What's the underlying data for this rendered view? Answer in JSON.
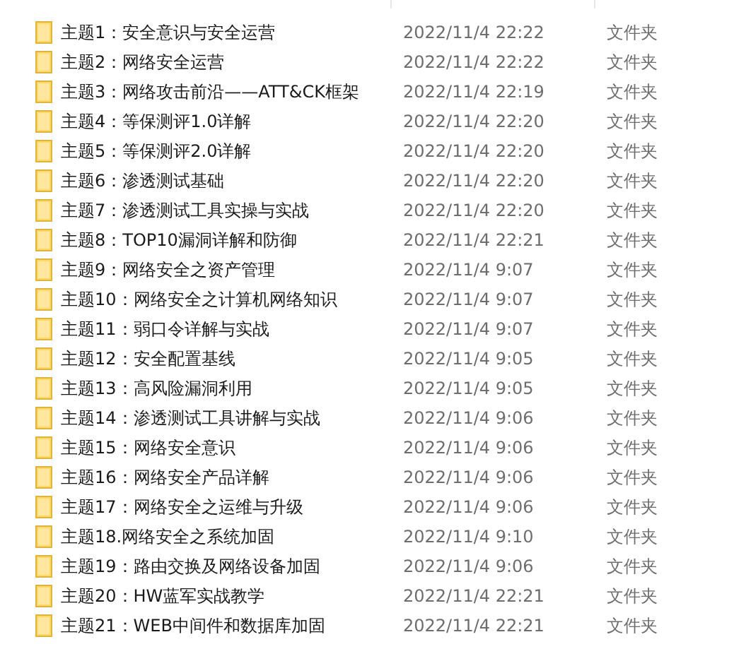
{
  "rows": [
    {
      "name": "主题1：安全意识与安全运营",
      "date": "2022/11/4 22:22",
      "type": "文件夹"
    },
    {
      "name": "主题2：网络安全运营",
      "date": "2022/11/4 22:22",
      "type": "文件夹"
    },
    {
      "name": "主题3：网络攻击前沿——ATT&CK框架",
      "date": "2022/11/4 22:19",
      "type": "文件夹"
    },
    {
      "name": "主题4：等保测评1.0详解",
      "date": "2022/11/4 22:20",
      "type": "文件夹"
    },
    {
      "name": "主题5：等保测评2.0详解",
      "date": "2022/11/4 22:20",
      "type": "文件夹"
    },
    {
      "name": "主题6：渗透测试基础",
      "date": "2022/11/4 22:20",
      "type": "文件夹"
    },
    {
      "name": "主题7：渗透测试工具实操与实战",
      "date": "2022/11/4 22:20",
      "type": "文件夹"
    },
    {
      "name": "主题8：TOP10漏洞详解和防御",
      "date": "2022/11/4 22:21",
      "type": "文件夹"
    },
    {
      "name": "主题9：网络安全之资产管理",
      "date": "2022/11/4 9:07",
      "type": "文件夹"
    },
    {
      "name": "主题10：网络安全之计算机网络知识",
      "date": "2022/11/4 9:07",
      "type": "文件夹"
    },
    {
      "name": "主题11：弱口令详解与实战",
      "date": "2022/11/4 9:07",
      "type": "文件夹"
    },
    {
      "name": "主题12：安全配置基线",
      "date": "2022/11/4 9:05",
      "type": "文件夹"
    },
    {
      "name": "主题13：高风险漏洞利用",
      "date": "2022/11/4 9:05",
      "type": "文件夹"
    },
    {
      "name": "主题14：渗透测试工具讲解与实战",
      "date": "2022/11/4 9:06",
      "type": "文件夹"
    },
    {
      "name": "主题15：网络安全意识",
      "date": "2022/11/4 9:06",
      "type": "文件夹"
    },
    {
      "name": "主题16：网络安全产品详解",
      "date": "2022/11/4 9:06",
      "type": "文件夹"
    },
    {
      "name": "主题17：网络安全之运维与升级",
      "date": "2022/11/4 9:06",
      "type": "文件夹"
    },
    {
      "name": "主题18.网络安全之系统加固",
      "date": "2022/11/4 9:10",
      "type": "文件夹"
    },
    {
      "name": "主题19：路由交换及网络设备加固",
      "date": "2022/11/4 9:06",
      "type": "文件夹"
    },
    {
      "name": "主题20：HW蓝军实战教学",
      "date": "2022/11/4 22:21",
      "type": "文件夹"
    },
    {
      "name": "主题21：WEB中间件和数据库加固",
      "date": "2022/11/4 22:21",
      "type": "文件夹"
    }
  ]
}
